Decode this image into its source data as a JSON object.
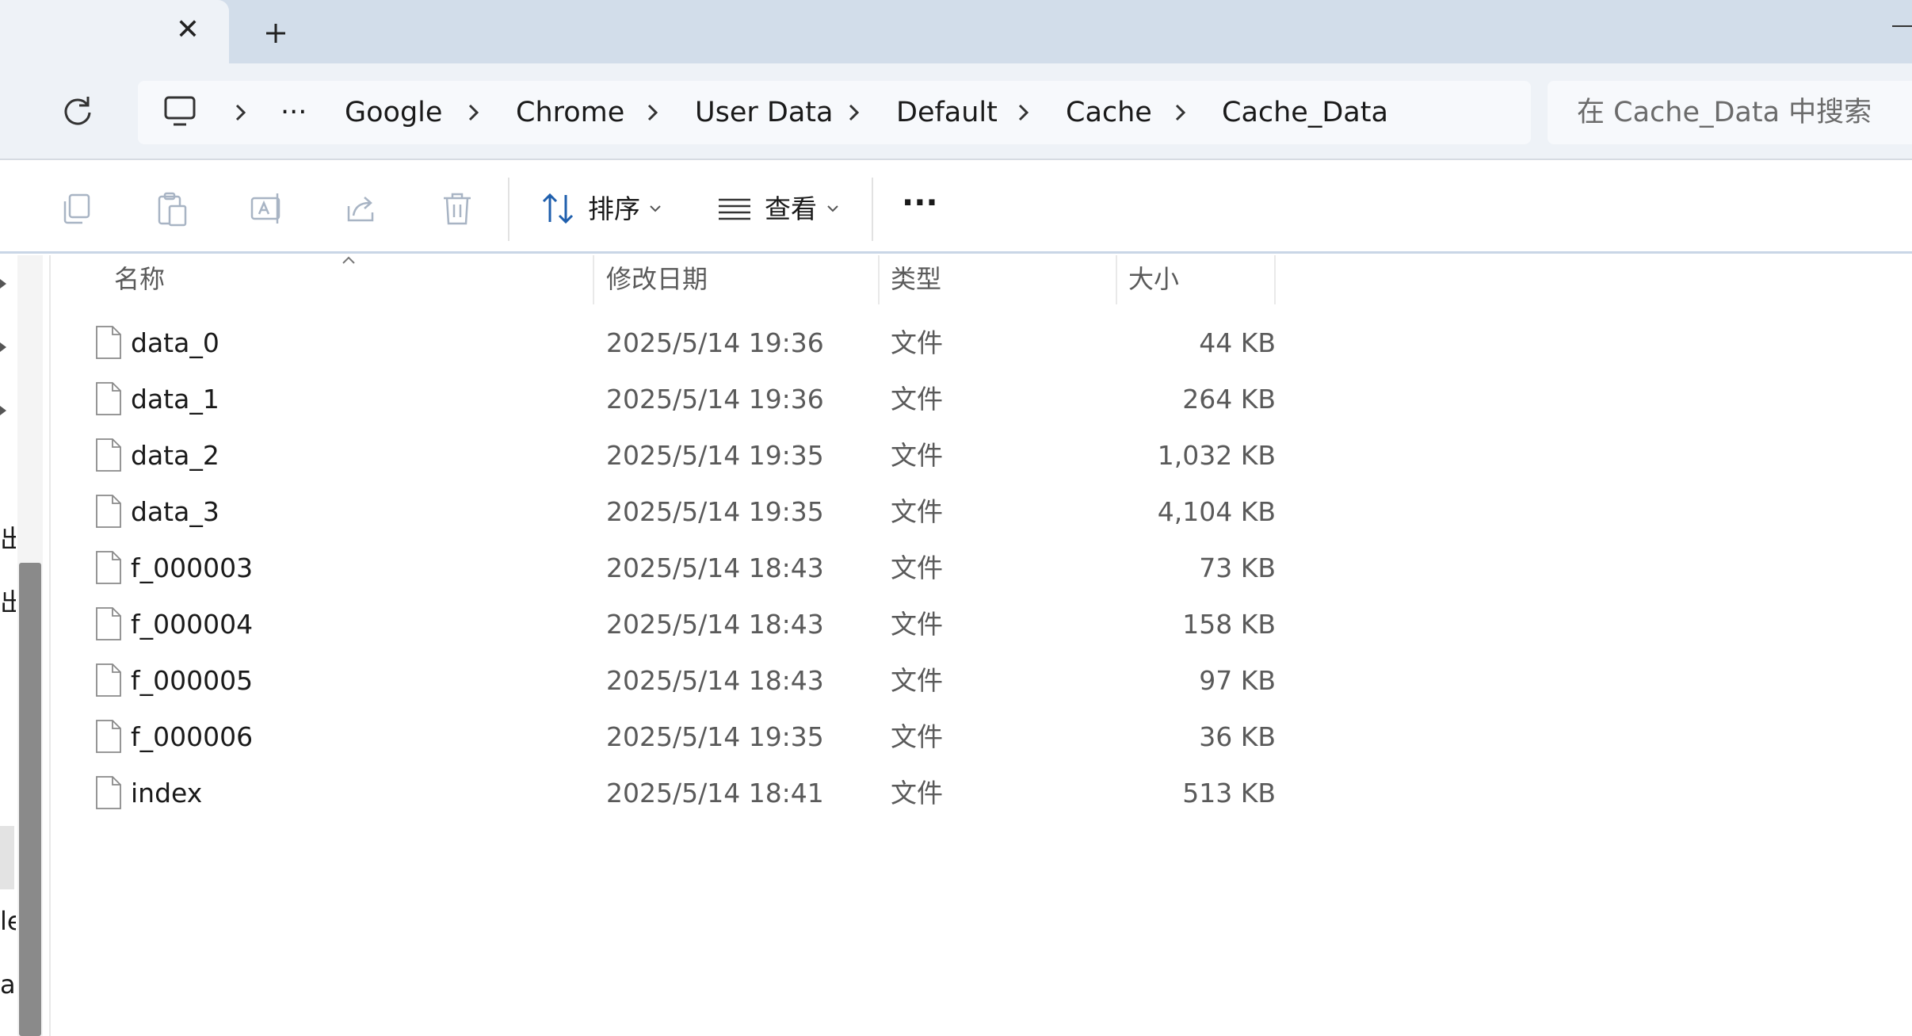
{
  "tabbar": {
    "close_glyph": "✕",
    "new_tab_icon": "plus-icon"
  },
  "nav": {
    "refresh_icon": "refresh-icon",
    "breadcrumb": {
      "pc_icon": "computer-icon",
      "overflow": "···",
      "items": [
        "Google",
        "Chrome",
        "User Data",
        "Default",
        "Cache",
        "Cache_Data"
      ]
    },
    "search": {
      "placeholder": "在 Cache_Data 中搜索"
    }
  },
  "toolbar": {
    "sort_label": "排序",
    "view_label": "查看",
    "more_label": "···"
  },
  "sidebar": {
    "fragments": [
      "出",
      "出",
      "le",
      "a"
    ]
  },
  "table": {
    "columns": {
      "name": "名称",
      "date": "修改日期",
      "type": "类型",
      "size": "大小"
    },
    "rows": [
      {
        "name": "data_0",
        "date": "2025/5/14 19:36",
        "type": "文件",
        "size": "44 KB"
      },
      {
        "name": "data_1",
        "date": "2025/5/14 19:36",
        "type": "文件",
        "size": "264 KB"
      },
      {
        "name": "data_2",
        "date": "2025/5/14 19:35",
        "type": "文件",
        "size": "1,032 KB"
      },
      {
        "name": "data_3",
        "date": "2025/5/14 19:35",
        "type": "文件",
        "size": "4,104 KB"
      },
      {
        "name": "f_000003",
        "date": "2025/5/14 18:43",
        "type": "文件",
        "size": "73 KB"
      },
      {
        "name": "f_000004",
        "date": "2025/5/14 18:43",
        "type": "文件",
        "size": "158 KB"
      },
      {
        "name": "f_000005",
        "date": "2025/5/14 18:43",
        "type": "文件",
        "size": "97 KB"
      },
      {
        "name": "f_000006",
        "date": "2025/5/14 19:35",
        "type": "文件",
        "size": "36 KB"
      },
      {
        "name": "index",
        "date": "2025/5/14 18:41",
        "type": "文件",
        "size": "513 KB"
      }
    ]
  }
}
